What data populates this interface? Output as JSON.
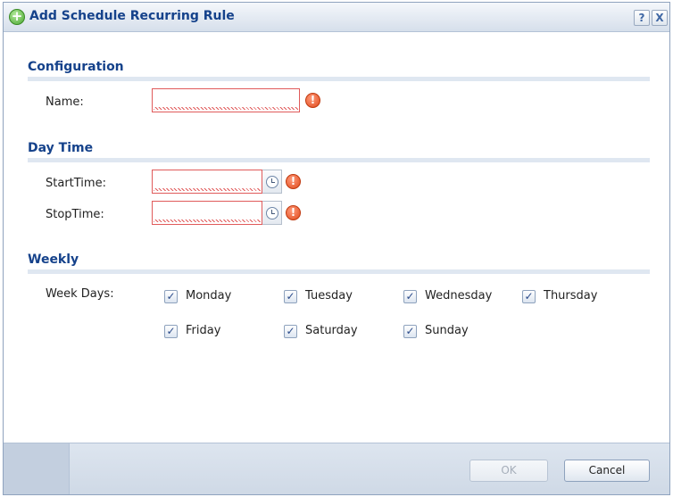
{
  "dialog": {
    "title": "Add Schedule Recurring Rule",
    "help_label": "?",
    "close_label": "X"
  },
  "configuration": {
    "heading": "Configuration",
    "name_label": "Name:",
    "name_value": ""
  },
  "day_time": {
    "heading": "Day Time",
    "start_label": "StartTime:",
    "start_value": "",
    "stop_label": "StopTime:",
    "stop_value": ""
  },
  "weekly": {
    "heading": "Weekly",
    "week_days_label": "Week Days:",
    "days": [
      {
        "label": "Monday",
        "checked": true
      },
      {
        "label": "Tuesday",
        "checked": true
      },
      {
        "label": "Wednesday",
        "checked": true
      },
      {
        "label": "Thursday",
        "checked": true
      },
      {
        "label": "Friday",
        "checked": true
      },
      {
        "label": "Saturday",
        "checked": true
      },
      {
        "label": "Sunday",
        "checked": true
      }
    ]
  },
  "footer": {
    "ok_label": "OK",
    "cancel_label": "Cancel"
  },
  "icons": {
    "add": "plus-circle-icon",
    "help": "help-icon",
    "close": "close-icon",
    "error": "error-icon",
    "clock": "clock-icon",
    "check": "checkmark-icon"
  },
  "colors": {
    "title_text": "#15428b",
    "error": "#e05a5a",
    "section_rule": "#dfe7f1"
  }
}
